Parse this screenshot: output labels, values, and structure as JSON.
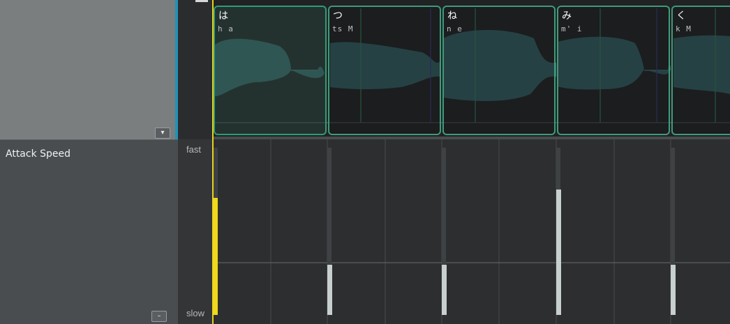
{
  "parameter": {
    "label": "Attack Speed",
    "scale_top": "fast",
    "scale_bottom": "slow"
  },
  "buttons": {
    "expand_icon": "chevron-down-icon",
    "collapse_icon": "minus-icon",
    "expand_glyph": "▾",
    "collapse_glyph": "–"
  },
  "notes": [
    {
      "lyric": "は",
      "phoneme": "h a",
      "attack_level": 0.7,
      "selected": true
    },
    {
      "lyric": "つ",
      "phoneme": "ts M",
      "attack_level": 0.3,
      "selected": false
    },
    {
      "lyric": "ね",
      "phoneme": "n e",
      "attack_level": 0.3,
      "selected": false
    },
    {
      "lyric": "み",
      "phoneme": "m' i",
      "attack_level": 0.75,
      "selected": false
    },
    {
      "lyric": "く",
      "phoneme": "k M",
      "attack_level": 0.3,
      "selected": false
    }
  ],
  "colors": {
    "playhead": "#e7d21e",
    "note_border": "#3f9b79",
    "waveform": "#3d7f82",
    "bar": "#c8cfcf",
    "first_bar": "#f0d81c",
    "panel_accent": "#1f93b8"
  }
}
